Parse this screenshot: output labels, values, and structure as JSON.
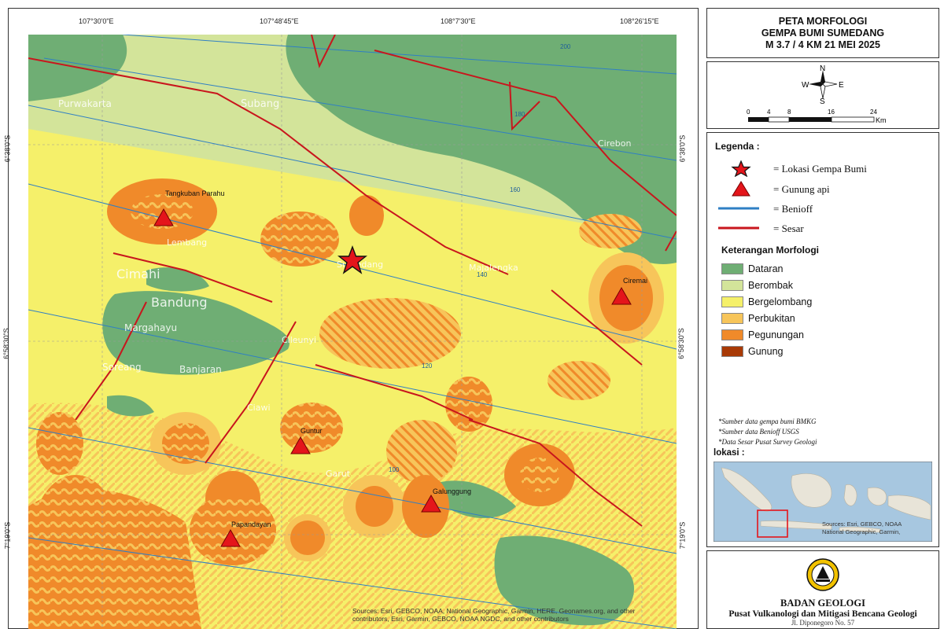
{
  "map": {
    "top_coords": [
      "107°30'0\"E",
      "107°48'45\"E",
      "108°7'30\"E",
      "108°26'15\"E"
    ],
    "left_coords": [
      "6°38'0\"S",
      "6°58'30\"S",
      "7°19'0\"S"
    ],
    "right_coords": [
      "6°38'0\"S",
      "6°58'30\"S",
      "7°19'0\"S"
    ],
    "place_labels": [
      "Subang",
      "Purwakarta",
      "Cimahi",
      "Bandung",
      "Margahayu",
      "Soreang",
      "Banjaran",
      "Cileunyi",
      "Sumedang",
      "Garut",
      "Lembang",
      "Ciawi",
      "Majalengka",
      "Cirebon"
    ],
    "volcano_labels": [
      "Tangkuban Parahu",
      "Ciremai",
      "Guntur",
      "Galunggung",
      "Papandayan"
    ],
    "benioff_labels": [
      "200",
      "180",
      "160",
      "140",
      "120",
      "100"
    ],
    "attribution_line1": "Sources: Esri, GEBCO, NOAA, National Geographic, Garmin, HERE, Geonames.org, and other",
    "attribution_line2": "contributors, Esri, Garmin, GEBCO, NOAA NGDC, and other contributors"
  },
  "title": {
    "line1": "PETA MORFOLOGI",
    "line2": "GEMPA BUMI SUMEDANG",
    "line3": "M 3.7 / 4 KM  21 MEI 2025"
  },
  "compass": {
    "n": "N",
    "s": "S",
    "e": "E",
    "w": "W",
    "scale_ticks": [
      "0",
      "4",
      "8",
      "16",
      "24"
    ],
    "scale_unit": "Km"
  },
  "legend": {
    "heading": "Legenda :",
    "symbols": [
      {
        "label": "= Lokasi Gempa Bumi",
        "icon": "star-icon"
      },
      {
        "label": "= Gunung api",
        "icon": "triangle-icon"
      },
      {
        "label": "= Benioff",
        "icon": "blue-line-icon"
      },
      {
        "label": "= Sesar",
        "icon": "red-line-icon"
      }
    ],
    "morph_heading": "Keterangan Morfologi",
    "classes": [
      {
        "label": "Dataran",
        "color": "#6fae74"
      },
      {
        "label": "Berombak",
        "color": "#d3e49a"
      },
      {
        "label": "Bergelombang",
        "color": "#f5f06a"
      },
      {
        "label": "Perbukitan",
        "color": "#f7c55a"
      },
      {
        "label": "Pegunungan",
        "color": "#f08a2a"
      },
      {
        "label": "Gunung",
        "color": "#a83a06"
      }
    ],
    "sources": [
      "*Sumber data gempa bumi BMKG",
      "*Sumber data Benioff USGS",
      "*Data Sesar Pusat Survey Geologi"
    ],
    "location_heading": "lokasi :",
    "location_attrib1": "Sources: Esri, GEBCO, NOAA",
    "location_attrib2": "National Geographic, Garmin,"
  },
  "agency": {
    "name": "BADAN GEOLOGI",
    "sub": "Pusat Vulkanologi dan Mitigasi Bencana Geologi",
    "address": "Jl. Diponegoro No. 57"
  },
  "colors": {
    "dataran": "#6fae74",
    "berombak": "#d3e49a",
    "bergelombang": "#f5f06a",
    "perbukitan": "#f7c55a",
    "pegunungan": "#f08a2a",
    "gunung": "#a83a06",
    "fault": "#c8161d",
    "benioff": "#2f7fc4",
    "volcano": "#e4151b"
  }
}
